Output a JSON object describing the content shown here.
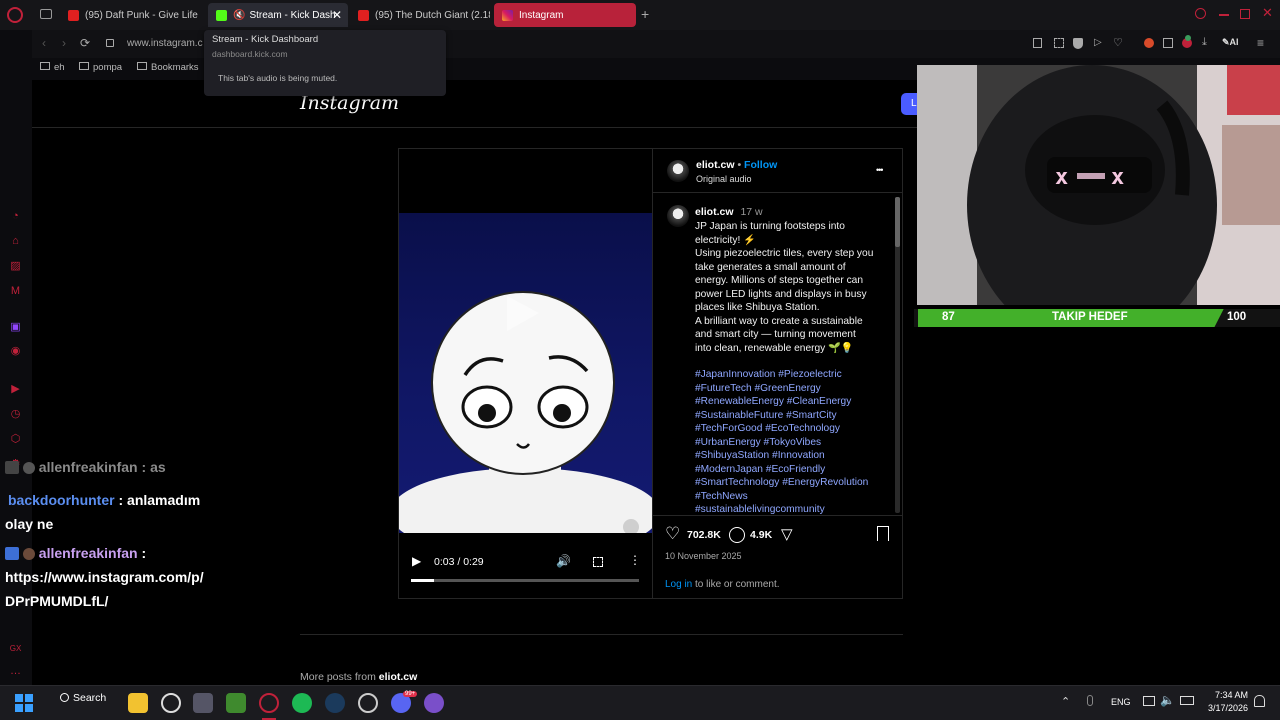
{
  "tabs": [
    {
      "label": "(95) Daft Punk - Give Life",
      "icon": "youtube-icon"
    },
    {
      "label": "Stream - Kick Dash",
      "icon": "kick-icon"
    },
    {
      "label": "(95) The Dutch Giant (2.18",
      "icon": "youtube-icon"
    },
    {
      "label": "Instagram",
      "icon": "instagram-icon"
    }
  ],
  "tooltip": {
    "title": "Stream - Kick Dashboard",
    "url": "dashboard.kick.com",
    "note": "This tab's audio is being muted."
  },
  "address": {
    "url": "www.instagram.c"
  },
  "bookmarks": [
    "eh",
    "pompa",
    "Bookmarks"
  ],
  "instagram": {
    "logo": "Instagram",
    "login_btn": "L",
    "author": "eliot.cw",
    "follow": "Follow",
    "dot": "•",
    "audio": "Original audio",
    "more": "•••",
    "caption_user": "eliot.cw",
    "caption_age": "17 w",
    "caption_lines": [
      "JP Japan is turning footsteps into",
      "electricity! ⚡",
      "Using piezoelectric tiles, every step you",
      "take generates a small amount of",
      "energy. Millions of steps together can",
      "power LED lights and displays in busy",
      "places like Shibuya Station.",
      "A brilliant way to create a sustainable",
      "and smart city — turning movement",
      "into clean, renewable energy 🌱💡"
    ],
    "hashtags": [
      "#JapanInnovation #Piezoelectric",
      "#FutureTech #GreenEnergy",
      "#RenewableEnergy #CleanEnergy",
      "#SustainableFuture #SmartCity",
      "#TechForGood #EcoTechnology",
      "#UrbanEnergy #TokyoVibes",
      "#ShibuyaStation #Innovation",
      "#ModernJapan #EcoFriendly",
      "#SmartTechnology #EnergyRevolution",
      "#TechNews",
      "#sustainablelivingcommunity"
    ],
    "likes": "702.8K",
    "comments": "4.9K",
    "date": "10 November 2025",
    "login_link": "Log in",
    "login_rest": " to like or comment.",
    "more_posts_prefix": "More posts from ",
    "more_posts_user": "eliot.cw",
    "video_time": "0:03 / 0:29",
    "video_progress": 0.1
  },
  "chat": [
    {
      "user": "allenfreakinfan",
      "sep": " : ",
      "text": "as",
      "color": "#9a9a9a"
    },
    {
      "user": "backdoorhunter",
      "sep": " : ",
      "text": "anlamadım",
      "text2": "olay ne",
      "color": "#5b8ef0"
    },
    {
      "user": "allenfreakinfan",
      "sep": " :",
      "text": "https://www.instagram.com/p/",
      "text2": "DPrPMUMDLfL/",
      "color": "#c8a0f0"
    }
  ],
  "goal": {
    "left": "87",
    "label": "TAKIP HEDEF",
    "right": "100",
    "progress": 0.87
  },
  "taskbar": {
    "search": "Search",
    "lang": "ENG",
    "time": "7:34 AM",
    "date": "3/17/2026",
    "badge": "99+"
  },
  "colors": {
    "accent": "#c0213a",
    "ig_link": "#0095f6",
    "goal_green": "#43b02a"
  }
}
